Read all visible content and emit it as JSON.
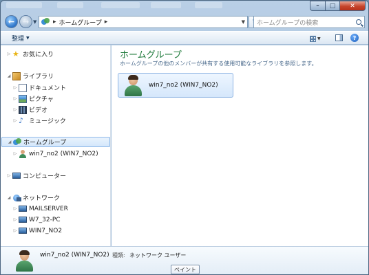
{
  "window": {
    "title_buttons": {
      "minimize": "–",
      "maximize": "□",
      "close": "✕"
    }
  },
  "navigation": {
    "address_crumb": "ホームグループ",
    "address_separator": "▸",
    "address_trailing": "▸",
    "search_placeholder": "ホームグループの検索"
  },
  "toolbar": {
    "organize_label": "整理",
    "help_label": "?"
  },
  "sidebar": {
    "items": [
      {
        "label": "お気に入り"
      },
      {
        "label": "ライブラリ"
      },
      {
        "label": "ドキュメント"
      },
      {
        "label": "ピクチャ"
      },
      {
        "label": "ビデオ"
      },
      {
        "label": "ミュージック"
      },
      {
        "label": "ホームグループ"
      },
      {
        "label": "win7_no2 (WIN7_NO2)"
      },
      {
        "label": "コンピューター"
      },
      {
        "label": "ネットワーク"
      },
      {
        "label": "MAILSERVER"
      },
      {
        "label": "W7_32-PC"
      },
      {
        "label": "WIN7_NO2"
      }
    ]
  },
  "main": {
    "title": "ホームグループ",
    "description": "ホームグループの他のメンバーが共有する使用可能なライブラリを参照します。",
    "members": [
      {
        "name": "win7_no2 (WIN7_NO2)"
      }
    ]
  },
  "details": {
    "name": "win7_no2 (WIN7_NO2)",
    "type_label": "種類:",
    "type_value": "ネットワーク ユーザー"
  },
  "tooltip": "ペイント",
  "colors": {
    "title_green": "#1e7a3a",
    "selection_blue": "#d3e7fb",
    "frame_blue": "#b9cfe6"
  }
}
